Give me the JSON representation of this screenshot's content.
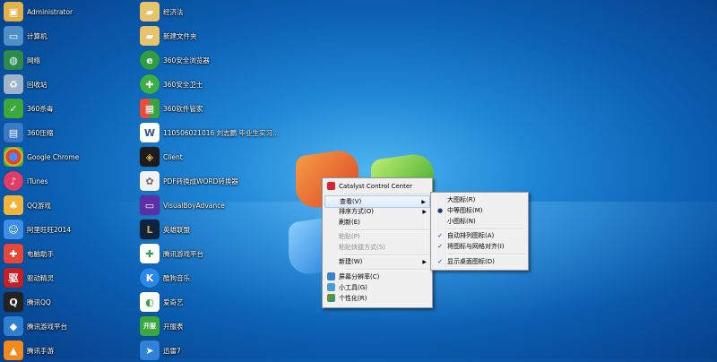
{
  "desktop": {
    "left_column": [
      {
        "label": "Administrator",
        "icon": "user-folder-icon"
      },
      {
        "label": "计算机",
        "icon": "computer-icon"
      },
      {
        "label": "网络",
        "icon": "network-icon"
      },
      {
        "label": "回收站",
        "icon": "recycle-bin-icon"
      },
      {
        "label": "360杀毒",
        "icon": "360-antivirus-icon"
      },
      {
        "label": "360压缩",
        "icon": "360-zip-icon"
      },
      {
        "label": "Google Chrome",
        "icon": "chrome-icon"
      },
      {
        "label": "iTunes",
        "icon": "itunes-icon"
      },
      {
        "label": "QQ游戏",
        "icon": "qq-game-icon"
      },
      {
        "label": "阿里旺旺2014",
        "icon": "aliwangwang-icon"
      },
      {
        "label": "电脑助手",
        "icon": "pc-assistant-icon"
      },
      {
        "label": "驱动精灵",
        "icon": "driver-genius-icon"
      },
      {
        "label": "腾讯QQ",
        "icon": "qq-icon"
      },
      {
        "label": "腾讯游戏平台",
        "icon": "tencent-games-icon"
      },
      {
        "label": "腾讯手游",
        "icon": "tencent-mobile-games-icon"
      }
    ],
    "right_column": [
      {
        "label": "经济法",
        "icon": "folder-icon"
      },
      {
        "label": "新建文件夹",
        "icon": "folder-icon"
      },
      {
        "label": "360安全浏览器",
        "icon": "360-browser-icon"
      },
      {
        "label": "360安全卫士",
        "icon": "360-safe-icon"
      },
      {
        "label": "360软件管家",
        "icon": "360-software-manager-icon"
      },
      {
        "label": "110506021016 刘志鹏 毕业生实习...",
        "icon": "word-document-icon"
      },
      {
        "label": "Client",
        "icon": "client-icon"
      },
      {
        "label": "PDF转换成WORD转换器",
        "icon": "pdf-converter-icon"
      },
      {
        "label": "VisualBoyAdvance",
        "icon": "visualboyadvance-icon"
      },
      {
        "label": "英雄联盟",
        "icon": "lol-icon"
      },
      {
        "label": "腾讯游戏平台",
        "icon": "tencent-games-platform-icon"
      },
      {
        "label": "酷狗音乐",
        "icon": "kugou-icon"
      },
      {
        "label": "爱奇艺",
        "icon": "iqiyi-icon"
      },
      {
        "label": "开服表",
        "icon": "server-list-icon"
      },
      {
        "label": "迅雷7",
        "icon": "xunlei-icon"
      }
    ]
  },
  "context_menu": {
    "items": [
      {
        "label": "Catalyst Control Center"
      },
      {
        "label": "查看(V)",
        "has_submenu": true
      },
      {
        "label": "排序方式(O)",
        "has_submenu": true
      },
      {
        "label": "刷新(E)"
      },
      {
        "label": "粘贴(P)",
        "disabled": true
      },
      {
        "label": "粘贴快捷方式(S)",
        "disabled": true
      },
      {
        "label": "新建(W)",
        "has_submenu": true
      },
      {
        "label": "屏幕分辨率(C)"
      },
      {
        "label": "小工具(G)"
      },
      {
        "label": "个性化(R)"
      }
    ],
    "arrow_glyph": "▶"
  },
  "view_submenu": {
    "items": [
      {
        "label": "大图标(R)",
        "mark": ""
      },
      {
        "label": "中等图标(M)",
        "mark": "●"
      },
      {
        "label": "小图标(N)",
        "mark": ""
      },
      {
        "label": "自动排列图标(A)",
        "mark": "✓"
      },
      {
        "label": "将图标与网格对齐(I)",
        "mark": "✓"
      },
      {
        "label": "显示桌面图标(D)",
        "mark": "✓"
      }
    ]
  },
  "colors": {
    "desktop_bg": "#1f86d6",
    "menu_bg": "#f0f0f0",
    "menu_highlight": "#dfeaf9"
  }
}
